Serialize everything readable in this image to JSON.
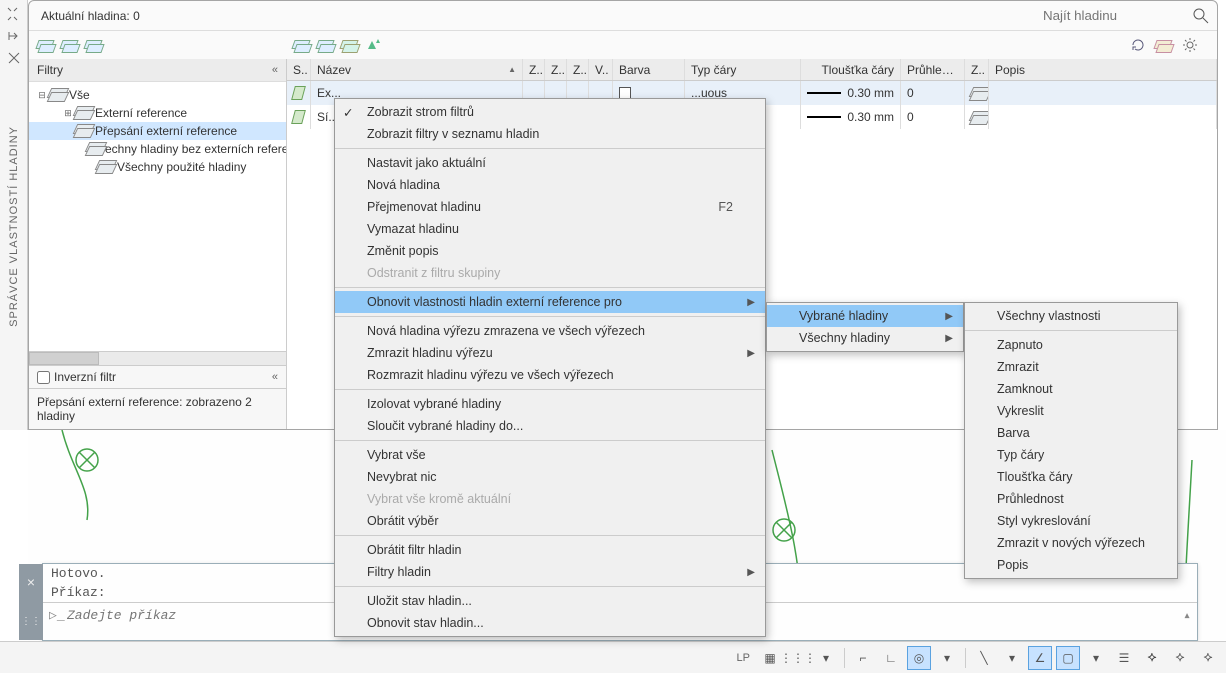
{
  "rail_title": "SPRÁVCE VLASTNOSTÍ HLADINY",
  "header": {
    "current_layer": "Aktuální hladina: 0",
    "find_placeholder": "Najít hladinu"
  },
  "filters": {
    "title": "Filtry"
  },
  "tree": [
    {
      "label": "Vše",
      "level": 0,
      "twisty": "−"
    },
    {
      "label": "Externí reference",
      "level": 1,
      "twisty": "+"
    },
    {
      "label": "Přepsání externí reference",
      "level": 1,
      "selected": true
    },
    {
      "label": "Všechny hladiny bez externích referencí",
      "level": 2
    },
    {
      "label": "Všechny použité hladiny",
      "level": 2
    }
  ],
  "invert_label": "Inverzní filtr",
  "columns": {
    "s": "S..",
    "name": "Název",
    "z1": "Z..",
    "z2": "Z..",
    "z3": "Z..",
    "v": "V..",
    "barva": "Barva",
    "typ": "Typ čáry",
    "tl": "Tloušťka čáry",
    "pr": "Průhle…",
    "zm": "Z..",
    "popis": "Popis"
  },
  "rows": [
    {
      "name": "Ex...",
      "typ": "...uous",
      "tl": "0.30 mm",
      "pr": "0"
    },
    {
      "name": "Sí...",
      "typ": "...uous",
      "tl": "0.30 mm",
      "pr": "0"
    }
  ],
  "grid_status": "Přepsání externí reference: zobrazeno 2 hladiny",
  "cmd": {
    "l1": "Hotovo.",
    "l2": "Příkaz:",
    "ph": "Zadejte příkaz"
  },
  "sb": {
    "lp": "LP"
  },
  "menu_main": [
    {
      "t": "Zobrazit strom filtrů",
      "check": true
    },
    {
      "t": "Zobrazit filtry v seznamu hladin"
    },
    {
      "sep": true
    },
    {
      "t": "Nastavit jako aktuální"
    },
    {
      "t": "Nová hladina"
    },
    {
      "t": "Přejmenovat hladinu",
      "hk": "F2"
    },
    {
      "t": "Vymazat hladinu"
    },
    {
      "t": "Změnit popis"
    },
    {
      "t": "Odstranit z filtru skupiny",
      "disabled": true
    },
    {
      "sep": true
    },
    {
      "t": "Obnovit vlastnosti hladin externí reference pro",
      "sub": true,
      "hl": true
    },
    {
      "sep": true
    },
    {
      "t": "Nová hladina výřezu zmrazena ve všech výřezech"
    },
    {
      "t": "Zmrazit hladinu výřezu",
      "sub": true
    },
    {
      "t": "Rozmrazit hladinu výřezu ve všech výřezech"
    },
    {
      "sep": true
    },
    {
      "t": "Izolovat vybrané hladiny"
    },
    {
      "t": "Sloučit vybrané hladiny do..."
    },
    {
      "sep": true
    },
    {
      "t": "Vybrat vše"
    },
    {
      "t": "Nevybrat nic"
    },
    {
      "t": "Vybrat vše kromě aktuální",
      "disabled": true
    },
    {
      "t": "Obrátit výběr"
    },
    {
      "sep": true
    },
    {
      "t": "Obrátit filtr hladin"
    },
    {
      "t": "Filtry hladin",
      "sub": true
    },
    {
      "sep": true
    },
    {
      "t": "Uložit stav hladin..."
    },
    {
      "t": "Obnovit stav hladin..."
    }
  ],
  "menu_sub1": [
    {
      "t": "Vybrané hladiny",
      "sub": true,
      "hl": true
    },
    {
      "t": "Všechny hladiny",
      "sub": true
    }
  ],
  "menu_sub2": [
    {
      "t": "Všechny vlastnosti"
    },
    {
      "sep": true
    },
    {
      "t": "Zapnuto"
    },
    {
      "t": "Zmrazit"
    },
    {
      "t": "Zamknout"
    },
    {
      "t": "Vykreslit"
    },
    {
      "t": "Barva"
    },
    {
      "t": "Typ čáry"
    },
    {
      "t": "Tloušťka čáry"
    },
    {
      "t": "Průhlednost"
    },
    {
      "t": "Styl vykreslování"
    },
    {
      "t": "Zmrazit v nových výřezech"
    },
    {
      "t": "Popis"
    }
  ]
}
